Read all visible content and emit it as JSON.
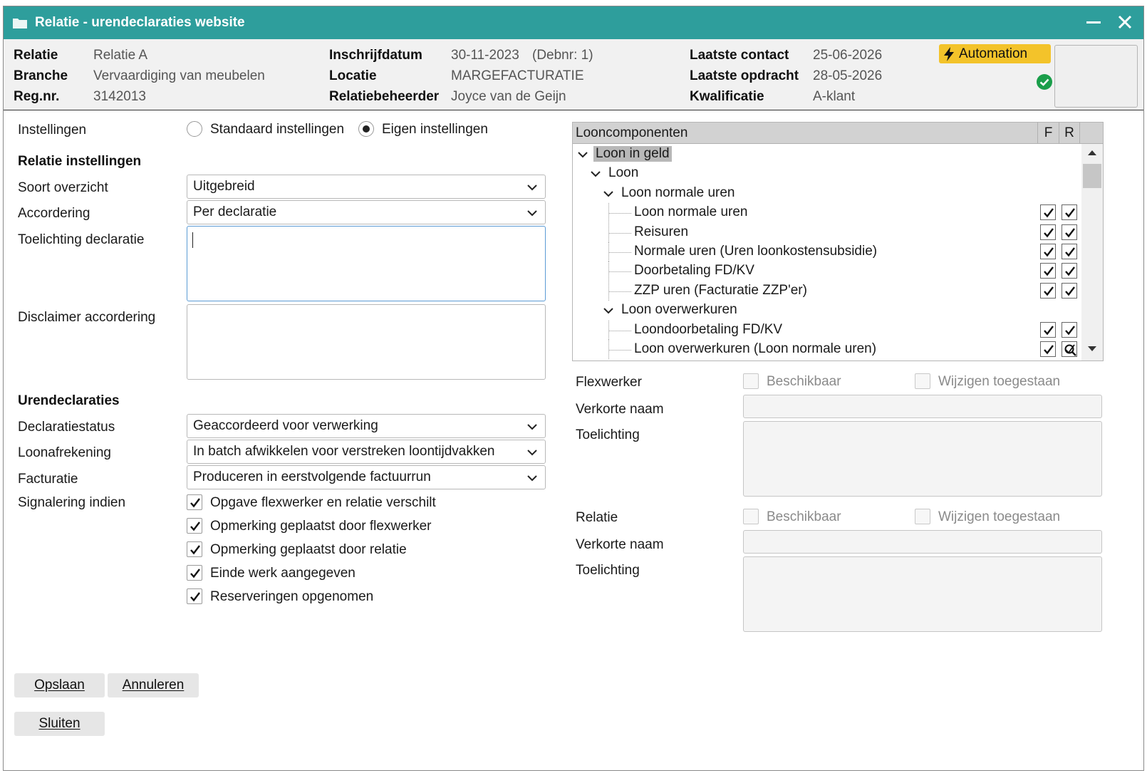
{
  "window": {
    "title": "Relatie - urendeclaraties website"
  },
  "header": {
    "relatie_label": "Relatie",
    "relatie_value": "Relatie A",
    "branche_label": "Branche",
    "branche_value": "Vervaardiging van meubelen",
    "regnr_label": "Reg.nr.",
    "regnr_value": "3142013",
    "inschrijf_label": "Inschrijfdatum",
    "inschrijf_value": "30-11-2023",
    "debnr": "(Debnr: 1)",
    "locatie_label": "Locatie",
    "locatie_value": "MARGEFACTURATIE",
    "beheerder_label": "Relatiebeheerder",
    "beheerder_value": "Joyce van de Geijn",
    "contact_label": "Laatste contact",
    "contact_value": "25-06-2026",
    "opdracht_label": "Laatste opdracht",
    "opdracht_value": "28-05-2026",
    "kwal_label": "Kwalificatie",
    "kwal_value": "A-klant",
    "automation_label": "Automation"
  },
  "settings": {
    "label": "Instellingen",
    "option_standard": "Standaard instellingen",
    "option_own": "Eigen instellingen",
    "selected": "own"
  },
  "relatie_instellingen": {
    "title": "Relatie instellingen",
    "soort_label": "Soort overzicht",
    "soort_value": "Uitgebreid",
    "accordering_label": "Accordering",
    "accordering_value": "Per declaratie",
    "toelichting_label": "Toelichting declaratie",
    "toelichting_value": "",
    "disclaimer_label": "Disclaimer accordering",
    "disclaimer_value": ""
  },
  "urendeclaraties": {
    "title": "Urendeclaraties",
    "status_label": "Declaratiestatus",
    "status_value": "Geaccordeerd voor verwerking",
    "loon_label": "Loonafrekening",
    "loon_value": "In batch afwikkelen voor verstreken loontijdvakken",
    "factuur_label": "Facturatie",
    "factuur_value": "Produceren in eerstvolgende factuurrun",
    "signalering_label": "Signalering indien",
    "signaleringen": [
      {
        "label": "Opgave flexwerker en relatie verschilt",
        "checked": true
      },
      {
        "label": "Opmerking geplaatst door flexwerker",
        "checked": true
      },
      {
        "label": "Opmerking geplaatst door relatie",
        "checked": true
      },
      {
        "label": "Einde werk aangegeven",
        "checked": true
      },
      {
        "label": "Reserveringen opgenomen",
        "checked": true
      }
    ]
  },
  "tree": {
    "header": "Looncomponenten",
    "col_f": "F",
    "col_r": "R",
    "rows": [
      {
        "label": "Loon in geld",
        "level": 0,
        "expanded": true,
        "selected": true
      },
      {
        "label": "Loon",
        "level": 1,
        "expanded": true
      },
      {
        "label": "Loon normale uren",
        "level": 2,
        "expanded": true
      },
      {
        "label": "Loon normale uren",
        "level": 3,
        "f": true,
        "r": true
      },
      {
        "label": "Reisuren",
        "level": 3,
        "f": true,
        "r": true
      },
      {
        "label": "Normale uren (Uren loonkostensubsidie)",
        "level": 3,
        "f": true,
        "r": true
      },
      {
        "label": "Doorbetaling FD/KV",
        "level": 3,
        "f": true,
        "r": true
      },
      {
        "label": "ZZP uren (Facturatie ZZP'er)",
        "level": 3,
        "f": true,
        "r": true
      },
      {
        "label": "Loon overwerkuren",
        "level": 2,
        "expanded": true
      },
      {
        "label": "Loondoorbetaling FD/KV",
        "level": 3,
        "f": true,
        "r": true
      },
      {
        "label": "Loon overwerkuren (Loon normale uren)",
        "level": 3,
        "f": true,
        "r": "search"
      }
    ]
  },
  "flexwerker": {
    "label": "Flexwerker",
    "beschikbaar": "Beschikbaar",
    "wijzigen": "Wijzigen toegestaan",
    "verkorte_label": "Verkorte naam",
    "verkorte_value": "",
    "toelichting_label": "Toelichting",
    "toelichting_value": ""
  },
  "relatie": {
    "label": "Relatie",
    "beschikbaar": "Beschikbaar",
    "wijzigen": "Wijzigen toegestaan",
    "verkorte_label": "Verkorte naam",
    "verkorte_value": "",
    "toelichting_label": "Toelichting",
    "toelichting_value": ""
  },
  "buttons": {
    "save": "Opslaan",
    "cancel": "Annuleren",
    "close": "Sluiten"
  },
  "colors": {
    "titlebar": "#2e9e9c",
    "automation": "#f3c32a",
    "ok": "#1a9e4a"
  }
}
